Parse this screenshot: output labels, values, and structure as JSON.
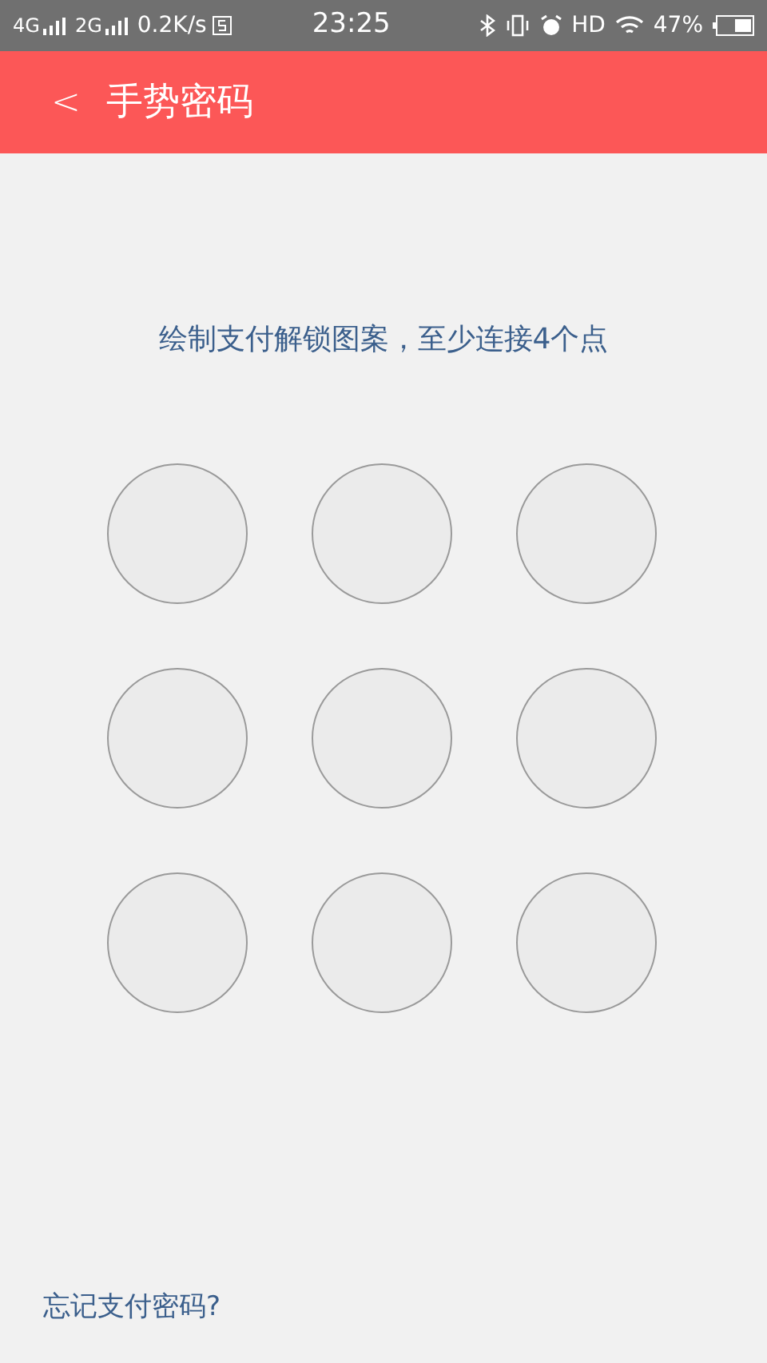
{
  "status_bar": {
    "network_1": "4G",
    "network_2": "2G",
    "speed": "0.2K/s",
    "time": "23:25",
    "hd": "HD",
    "battery": "47%"
  },
  "header": {
    "back": "<",
    "title": "手势密码"
  },
  "hint": "绘制支付解锁图案，至少连接4个点",
  "forgot_link": "忘记支付密码?"
}
